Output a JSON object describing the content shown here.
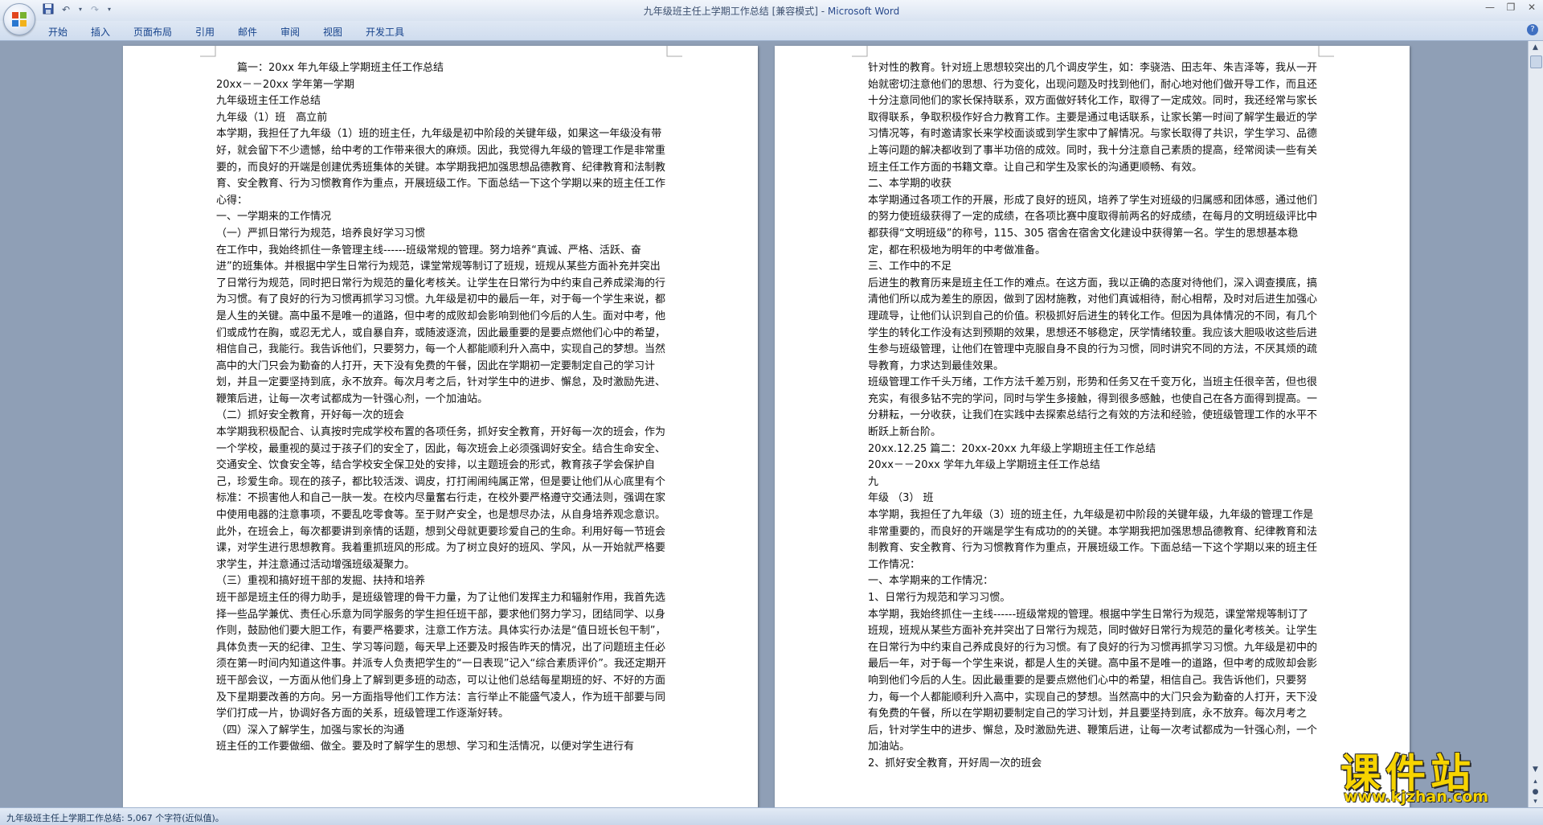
{
  "window": {
    "title": "九年级班主任上学期工作总结 [兼容模式] - ",
    "app_name": "Microsoft Word"
  },
  "qat": {
    "save_icon": "save-icon",
    "undo_icon": "undo-icon",
    "redo_icon": "redo-icon",
    "customize_icon": "chevron-down-icon"
  },
  "ribbon": {
    "tabs": [
      "开始",
      "插入",
      "页面布局",
      "引用",
      "邮件",
      "审阅",
      "视图",
      "开发工具"
    ]
  },
  "left_page": {
    "paragraphs": [
      "　　篇一：20xx 年九年级上学期班主任工作总结",
      "20xx－－20xx 学年第一学期",
      "九年级班主任工作总结",
      "九年级（1）班　高立前",
      "本学期，我担任了九年级（1）班的班主任，九年级是初中阶段的关键年级，如果这一年级没有带好，就会留下不少遗憾，给中考的工作带来很大的麻烦。因此，我觉得九年级的管理工作是非常重要的，而良好的开端是创建优秀班集体的关键。本学期我把加强思想品德教育、纪律教育和法制教育、安全教育、行为习惯教育作为重点，开展班级工作。下面总结一下这个学期以来的班主任工作心得：",
      "一、一学期来的工作情况",
      "（一）严抓日常行为规范，培养良好学习习惯",
      "在工作中，我始终抓住一条管理主线------班级常规的管理。努力培养“真诚、严格、活跃、奋进”的班集体。并根据中学生日常行为规范，课堂常规等制订了班规，班规从某些方面补充并突出了日常行为规范，同时把日常行为规范的量化考核关。让学生在日常行为中约束自己养成梁海的行为习惯。有了良好的行为习惯再抓学习习惯。九年级是初中的最后一年，对于每一个学生来说，都是人生的关键。高中虽不是唯一的道路，但中考的成败却会影响到他们今后的人生。面对中考，他们或成竹在胸，或忍无尤人，或自暴自弃，或随波逐流，因此最重要的是要点燃他们心中的希望，相信自己，我能行。我告诉他们，只要努力，每一个人都能顺利升入高中，实现自己的梦想。当然高中的大门只会为勤奋的人打开，天下没有免费的午餐，因此在学期初一定要制定自己的学习计划，并且一定要坚持到底，永不放弃。每次月考之后，针对学生中的进步、懈怠，及时激励先进、鞭策后进，让每一次考试都成为一针强心剂，一个加油站。",
      "（二）抓好安全教育，开好每一次的班会",
      "本学期我积极配合、认真按时完成学校布置的各项任务，抓好安全教育，开好每一次的班会，作为一个学校，最重视的莫过于孩子们的安全了，因此，每次班会上必须强调好安全。结合生命安全、交通安全、饮食安全等，结合学校安全保卫处的安排，以主题班会的形式，教育孩子学会保护自己，珍爱生命。现在的孩子，都比较活泼、调皮，打打闹闹纯属正常，但是要让他们从心底里有个标准：不损害他人和自己一肤一发。在校内尽量奮右行走，在校外要严格遵守交通法则，强调在家中使用电器的注意事项，不要乱吃零食等。至于财产安全，也是想尽办法，从自身培养观念意识。此外，在班会上，每次都要讲到亲情的话题，想到父母就更要珍爱自己的生命。利用好每一节班会课，对学生进行思想教育。我着重抓班风的形成。为了树立良好的班风、学风，从一开始就严格要求学生，并注意通过活动增强班级凝聚力。",
      "（三）重视和搞好班干部的发掘、扶持和培养",
      "班干部是班主任的得力助手，是班级管理的骨干力量，为了让他们发挥主力和辐射作用，我首先选择一些品学兼优、责任心乐意为同学服务的学生担任班干部，要求他们努力学习，团结同学、以身作则，鼓励他们要大胆工作，有要严格要求，注意工作方法。具体实行办法是“值日班长包干制”，具体负责一天的纪律、卫生、学习等问题，每天早上还要及时报告昨天的情况，出了问题班主任必须在第一时间内知道这件事。并派专人负责把学生的“一日表现”记入“综合素质评价”。我还定期开班干部会议，一方面从他们身上了解到更多班的动态，可以让他们总结每星期班的好、不好的方面及下星期要改善的方向。另一方面指导他们工作方法：言行举止不能盛气凌人，作为班干部要与同学们打成一片，协调好各方面的关系，班级管理工作逐渐好转。",
      "（四）深入了解学生，加强与家长的沟通",
      "班主任的工作要做细、做全。要及时了解学生的思想、学习和生活情况，以便对学生进行有"
    ]
  },
  "right_page": {
    "paragraphs": [
      "针对性的教育。针对班上思想较突出的几个调皮学生，如：李骁浩、田志年、朱吉泽等，我从一开始就密切注意他们的思想、行为变化，出现问题及时找到他们，耐心地对他们做开导工作，而且还十分注意同他们的家长保持联系，双方面做好转化工作，取得了一定成效。同时，我还经常与家长取得联系，争取积极作好合力教育工作。主要是通过电话联系，让家长第一时间了解学生最近的学习情况等，有时邀请家长来学校面谈或到学生家中了解情况。与家长取得了共识，学生学习、品德上等问题的解决都收到了事半功倍的成效。同时，我十分注意自己素质的提高，经常阅读一些有关班主任工作方面的书籍文章。让自己和学生及家长的沟通更顺畅、有效。",
      "二、本学期的收获",
      "本学期通过各项工作的开展，形成了良好的班风，培养了学生对班级的归属感和团体感，通过他们的努力使班级获得了一定的成绩，在各项比赛中度取得前两名的好成绩，在每月的文明班级评比中都获得“文明班级”的称号，115、305 宿舍在宿舍文化建设中获得第一名。学生的思想基本稳定，都在积极地为明年的中考做准备。",
      "三、工作中的不足",
      "后进生的教育历来是班主任工作的难点。在这方面，我以正确的态度对待他们，深入调查摸底，搞清他们所以成为差生的原因，做到了因材施教，对他们真诚相待，耐心相帮，及时对后进生加强心理疏导，让他们认识到自己的价值。积极抓好后进生的转化工作。但因为具体情况的不同，有几个学生的转化工作没有达到预期的效果，思想还不够稳定，厌学情绪较重。我应该大胆吸收这些后进生参与班级管理，让他们在管理中克服自身不良的行为习惯，同时讲究不同的方法，不厌其烦的疏导教育，力求达到最佳效果。",
      "班级管理工作千头万绪，工作方法千差万别，形势和任务又在千变万化，当班主任很辛苦，但也很充实，有很多钻不完的学问，同时与学生多接触，得到很多感触，也使自己在各方面得到提高。一分耕耘，一分收获，让我们在实践中去探索总结行之有效的方法和经验，使班级管理工作的水平不断跃上新台阶。",
      " 20xx.12.25 篇二：20xx-20xx 九年级上学期班主任工作总结",
      "20xx－－20xx 学年九年级上学期班主任工作总结",
      " 九",
      "年级 （3） 班",
      "本学期，我担任了九年级（3）班的班主任，九年级是初中阶段的关键年级，九年级的管理工作是非常重要的，而良好的开端是学生有成功的的关键。本学期我把加强思想品德教育、纪律教育和法制教育、安全教育、行为习惯教育作为重点，开展班级工作。下面总结一下这个学期以来的班主任工作情况：",
      "一、本学期来的工作情况：",
      "1、日常行为规范和学习习惯。",
      "本学期，我始终抓住一主线------班级常规的管理。根据中学生日常行为规范，课堂常规等制订了班规，班规从某些方面补充并突出了日常行为规范，同时做好日常行为规范的量化考核关。让学生在日常行为中约束自己养成良好的行为习惯。有了良好的行为习惯再抓学习习惯。九年级是初中的最后一年，对于每一个学生来说，都是人生的关键。高中虽不是唯一的道路，但中考的成败却会影响到他们今后的人生。因此最重要的是要点燃他们心中的希望，相信自己。我告诉他们，只要努力，每一个人都能顺利升入高中，实现自己的梦想。当然高中的大门只会为勤奋的人打开，天下没有免费的午餐，所以在学期初要制定自己的学习计划，并且要坚持到底，永不放弃。每次月考之后，针对学生中的进步、懈怠，及时激励先进、鞭策后进，让每一次考试都成为一针强心剂，一个加油站。",
      "2、抓好安全教育，开好周一次的班会"
    ]
  },
  "status_bar": {
    "text": "九年级班主任上学期工作总结: 5,067 个字符(近似值)。"
  },
  "watermark": {
    "big": "课件站",
    "url": "www.kjzhan.com"
  }
}
